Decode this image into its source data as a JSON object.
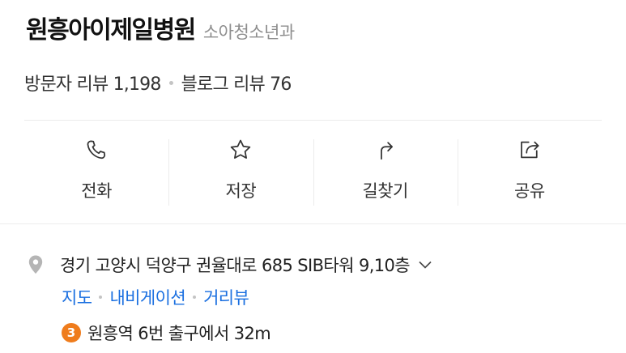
{
  "place": {
    "name": "원흥아이제일병원",
    "category": "소아청소년과"
  },
  "reviews": {
    "visitor": "방문자 리뷰 1,198",
    "blog": "블로그 리뷰 76"
  },
  "actions": [
    {
      "label": "전화",
      "icon": "phone-icon"
    },
    {
      "label": "저장",
      "icon": "star-icon"
    },
    {
      "label": "길찾기",
      "icon": "directions-icon"
    },
    {
      "label": "공유",
      "icon": "share-icon"
    }
  ],
  "address": {
    "text": "경기 고양시 덕양구 권율대로 685 SIB타워 9,10층",
    "icon": "location-pin-icon",
    "links": [
      "지도",
      "내비게이션",
      "거리뷰"
    ]
  },
  "subway": {
    "line": "3",
    "line_color": "#ef7c1c",
    "text": "원흥역 6번 출구에서 32m"
  },
  "colors": {
    "link": "#1a6fe0",
    "muted": "#8e8e8e"
  }
}
